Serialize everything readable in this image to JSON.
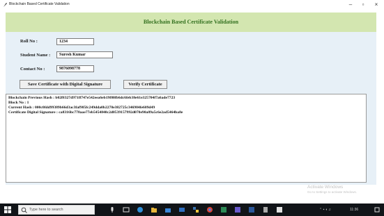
{
  "window": {
    "title": "Blockchain Based Certificate Validation",
    "controls": {
      "minimize": "–",
      "maximize": "▫",
      "close": "×"
    }
  },
  "header": {
    "title": "Blockchain Based Certificate Validation"
  },
  "form": {
    "roll_label": "Roll No :",
    "roll_value": "1234",
    "name_label": "Student Name :",
    "name_value": "Suresh Kumar",
    "contact_label": "Contact No :",
    "contact_value": "9876098778"
  },
  "buttons": {
    "save_label": "Save Certificate with Digital Signature",
    "verify_label": "Verify Certificate"
  },
  "result": {
    "lines": [
      "Blockchain Previous Hash : b02f8327d971ff747e542eea6eb19f80fb6dc6feb38e61e325704f7a6ade7723",
      "Block No : 1",
      "Current Hash : 000c0fdd99389b66d3ac3faf985fc249dda0b2278e382725c346984fe609d49",
      "Certificate Digital Signature : ca8316bc778aae77eb5454840c2d0539157992d070e90a89a5c6e2ad5464ba8e"
    ]
  },
  "watermark": {
    "title": "Activate Windows",
    "subtitle": "Go to Settings to activate Windows."
  },
  "taskbar": {
    "search_placeholder": "Type here to search",
    "time": "11:36",
    "date": "30-01-2024"
  },
  "colors": {
    "header_band": "#d3e6b0",
    "header_text": "#33701f",
    "form_background": "#e7f0f7",
    "taskbar": "#111418"
  }
}
